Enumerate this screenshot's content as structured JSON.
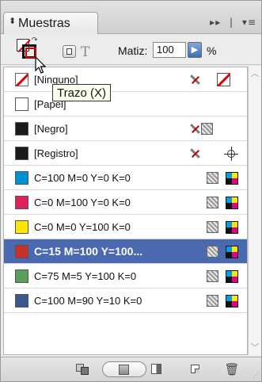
{
  "panel": {
    "tab_label": "Muestras",
    "tab_arrows_icon": "collapse-arrows-icon",
    "header_icons": [
      "double-arrow-icon",
      "panel-menu-icon"
    ]
  },
  "controls": {
    "hue_label": "Matiz:",
    "hue_value": "100",
    "hue_unit": "%",
    "text_icon_glyph": "T"
  },
  "tooltip": {
    "text": "Trazo (X)"
  },
  "swatches": [
    {
      "label": "[Ninguno]",
      "color": "none",
      "non_editable": true,
      "type": "none"
    },
    {
      "label": "[Papel]",
      "color": "#ffffff",
      "type": "plain"
    },
    {
      "label": "[Negro]",
      "color": "#1a1a1a",
      "non_editable": true,
      "type": "process"
    },
    {
      "label": "[Registro]",
      "color": "#1a1a1a",
      "non_editable": true,
      "type": "registration"
    },
    {
      "label": "C=100 M=0 Y=0 K=0",
      "color": "#0090d6",
      "type": "cmyk"
    },
    {
      "label": "C=0 M=100 Y=0 K=0",
      "color": "#e0205a",
      "type": "cmyk"
    },
    {
      "label": "C=0 M=0 Y=100 K=0",
      "color": "#ffe600",
      "type": "cmyk"
    },
    {
      "label": "C=15 M=100 Y=100...",
      "color": "#c8302a",
      "type": "cmyk",
      "selected": true
    },
    {
      "label": "C=75 M=5 Y=100 K=0",
      "color": "#5a9e5c",
      "type": "cmyk"
    },
    {
      "label": "C=100 M=90 Y=10 K=0",
      "color": "#3a5a8c",
      "type": "cmyk"
    }
  ],
  "colors": {
    "selection": "#4a69b0",
    "panel_bg": "#ececec"
  }
}
